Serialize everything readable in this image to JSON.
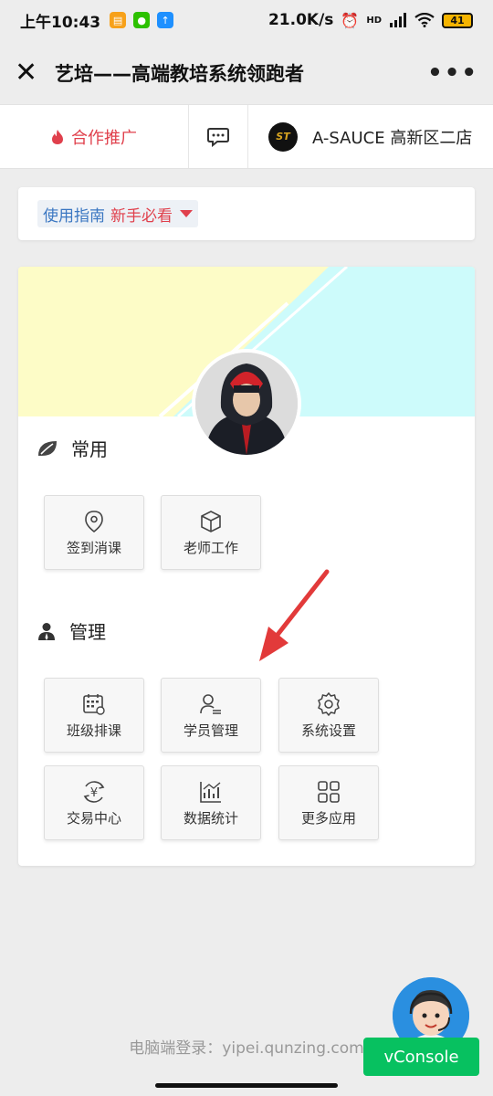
{
  "statusbar": {
    "time": "上午10:43",
    "net_speed": "21.0K/s",
    "signal": "HD",
    "battery": "41"
  },
  "titlebar": {
    "title": "艺培——高端教培系统领跑者"
  },
  "tabs": {
    "promo": "合作推广",
    "store": "A-SAUCE 高新区二店"
  },
  "guide": {
    "label_blue": "使用指南",
    "label_red": "新手必看"
  },
  "sections": {
    "common": {
      "title": "常用",
      "items": [
        {
          "label": "签到消课"
        },
        {
          "label": "老师工作"
        }
      ]
    },
    "manage": {
      "title": "管理",
      "items": [
        {
          "label": "班级排课"
        },
        {
          "label": "学员管理"
        },
        {
          "label": "系统设置"
        },
        {
          "label": "交易中心"
        },
        {
          "label": "数据统计"
        },
        {
          "label": "更多应用"
        }
      ]
    }
  },
  "footer": {
    "login_text": "电脑端登录：yipei.qunzing.com",
    "vconsole": "vConsole"
  },
  "colors": {
    "accent_red": "#e0404c",
    "link_blue": "#3b77c2",
    "vconsole_green": "#07c160",
    "banner_yellow": "#fdfcc7",
    "banner_cyan": "#cdfbfb"
  }
}
